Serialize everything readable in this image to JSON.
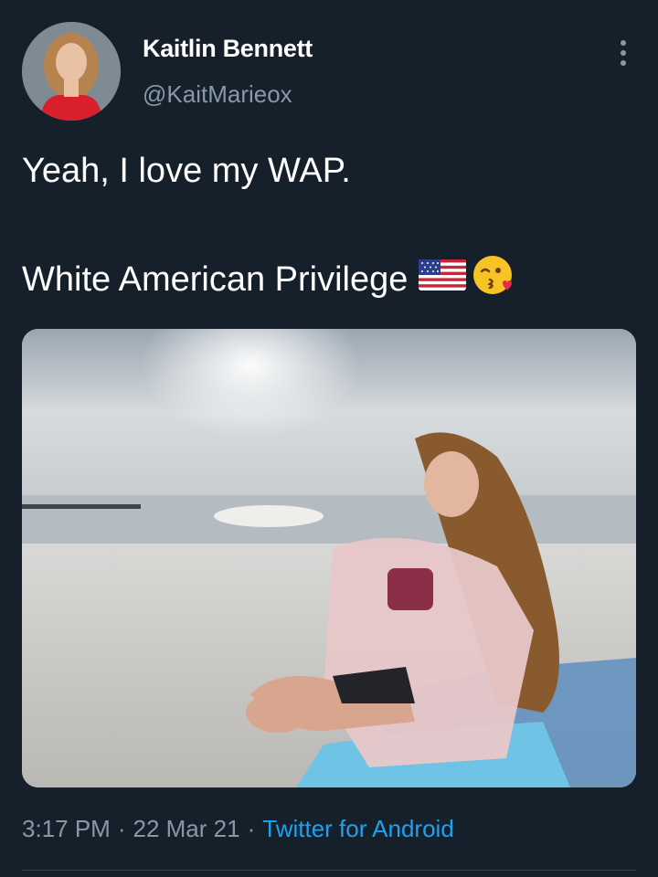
{
  "tweet": {
    "author": {
      "display_name": "Kaitlin Bennett",
      "handle": "@KaitMarieox"
    },
    "text_line1": "Yeah, I love my WAP.",
    "text_line2": "White American Privilege",
    "emojis": [
      "us-flag",
      "face-blowing-a-kiss"
    ],
    "meta": {
      "time": "3:17 PM",
      "separator": "·",
      "date": "22 Mar 21",
      "source": "Twitter for Android"
    }
  },
  "icons": {
    "more": "more-vertical-icon"
  },
  "colors": {
    "background": "#15202b",
    "primary_text": "#ffffff",
    "secondary_text": "#8899a6",
    "link": "#1da1f2"
  }
}
